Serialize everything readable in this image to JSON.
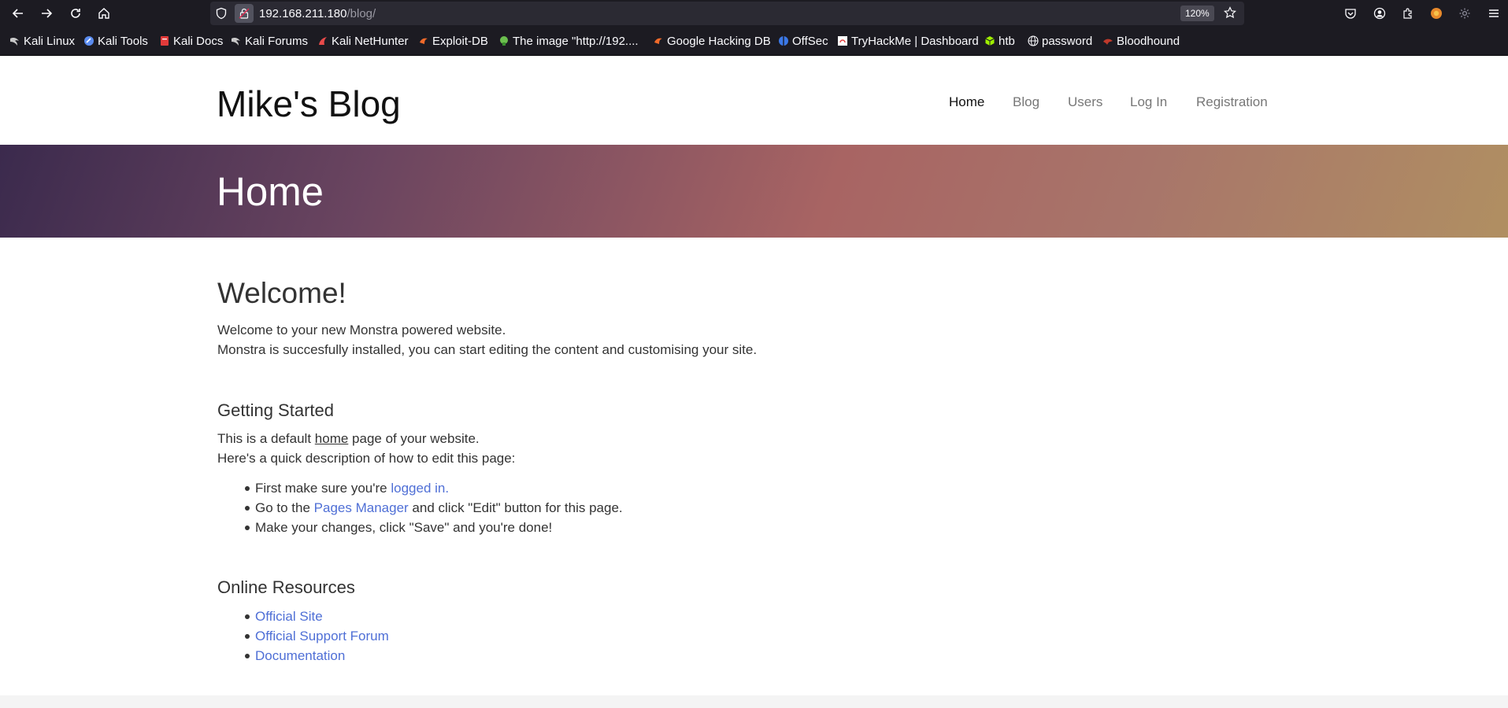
{
  "browser": {
    "url_host": "192.168.211.180",
    "url_path": "/blog/",
    "zoom": "120%",
    "bookmarks": [
      {
        "label": "Kali Linux",
        "icon": "kali-dragon-icon",
        "color": "#c9c9c9"
      },
      {
        "label": "Kali Tools",
        "icon": "kali-tools-icon",
        "color": "#5b8cf0"
      },
      {
        "label": "Kali Docs",
        "icon": "kali-docs-icon",
        "color": "#e23b3b"
      },
      {
        "label": "Kali Forums",
        "icon": "kali-dragon-icon",
        "color": "#c9c9c9"
      },
      {
        "label": "Kali NetHunter",
        "icon": "nethunter-icon",
        "color": "#e84a4a"
      },
      {
        "label": "Exploit-DB",
        "icon": "exploitdb-icon",
        "color": "#f06a2a"
      },
      {
        "label": "The image \"http://192....",
        "icon": "image-icon",
        "color": "#6bbf4e"
      },
      {
        "label": "Google Hacking DB",
        "icon": "ghdb-icon",
        "color": "#f06a2a"
      },
      {
        "label": "OffSec",
        "icon": "offsec-icon",
        "color": "#3b78e7"
      },
      {
        "label": "TryHackMe | Dashboard",
        "icon": "tryhackme-icon",
        "color": "#e23b3b"
      },
      {
        "label": "htb",
        "icon": "htb-cube-icon",
        "color": "#9fef00"
      },
      {
        "label": "password",
        "icon": "globe-icon",
        "color": "#fbfbfe"
      },
      {
        "label": "Bloodhound",
        "icon": "bloodhound-icon",
        "color": "#c0392b"
      }
    ]
  },
  "site": {
    "brand": "Mike's Blog",
    "nav": [
      {
        "label": "Home",
        "active": true
      },
      {
        "label": "Blog",
        "active": false
      },
      {
        "label": "Users",
        "active": false
      },
      {
        "label": "Log In",
        "active": false
      },
      {
        "label": "Registration",
        "active": false
      }
    ],
    "hero_title": "Home"
  },
  "content": {
    "heading": "Welcome!",
    "intro_line1": "Welcome to your new Monstra powered website.",
    "intro_line2": "Monstra is succesfully installed, you can start editing the content and customising your site.",
    "getting_started": {
      "heading": "Getting Started",
      "line1_before": "This is a default ",
      "line1_link": "home",
      "line1_after": " page of your website.",
      "line2": "Here's a quick description of how to edit this page:",
      "steps": {
        "step1_before": "First make sure you're ",
        "step1_link": "logged in.",
        "step2_before": "Go to the ",
        "step2_link": "Pages Manager",
        "step2_after": " and click \"Edit\" button for this page.",
        "step3": "Make your changes, click \"Save\" and you're done!"
      }
    },
    "online_resources": {
      "heading": "Online Resources",
      "links": [
        "Official Site",
        "Official Support Forum",
        "Documentation"
      ]
    }
  },
  "colors": {
    "link": "#4f6fd6",
    "chrome_bg": "#1c1b22",
    "hero_start": "#3b2a4d",
    "hero_mid": "#a86463",
    "hero_end": "#b08f62"
  }
}
